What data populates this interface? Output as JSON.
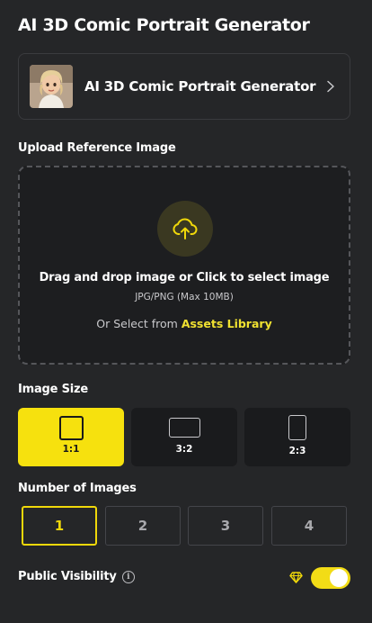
{
  "page_title": "AI 3D Comic Portrait Generator",
  "model_card": {
    "name": "AI 3D Comic Portrait Generator",
    "thumbnail_icon": "cartoon-woman-portrait"
  },
  "upload": {
    "section_label": "Upload Reference Image",
    "title": "Drag and drop image or Click to select image",
    "hint": "JPG/PNG (Max 10MB)",
    "assets_prefix": "Or Select from",
    "assets_link": "Assets Library"
  },
  "image_size": {
    "section_label": "Image Size",
    "options": [
      {
        "label": "1:1",
        "selected": true
      },
      {
        "label": "3:2",
        "selected": false
      },
      {
        "label": "2:3",
        "selected": false
      }
    ]
  },
  "num_images": {
    "section_label": "Number of Images",
    "options": [
      {
        "label": "1",
        "selected": true
      },
      {
        "label": "2",
        "selected": false
      },
      {
        "label": "3",
        "selected": false
      },
      {
        "label": "4",
        "selected": false
      }
    ]
  },
  "visibility": {
    "label": "Public Visibility",
    "info_icon": "i",
    "enabled": true
  },
  "colors": {
    "background": "#252628",
    "accent": "#f6e10e",
    "link": "#f0e131"
  }
}
